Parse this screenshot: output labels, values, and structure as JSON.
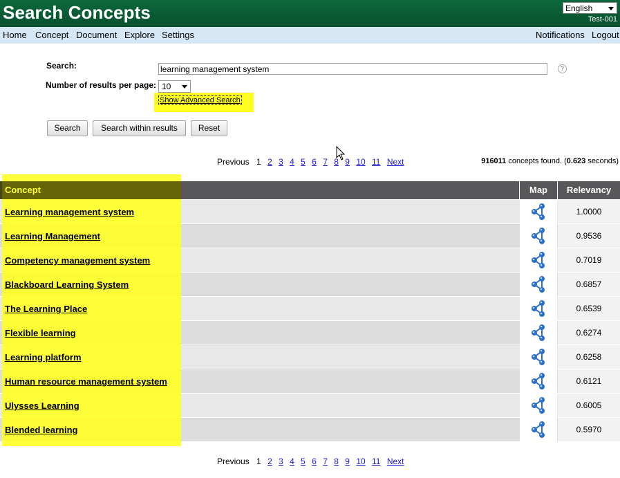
{
  "header": {
    "title": "Search Concepts",
    "language": "English",
    "user": "Test-001"
  },
  "menu": {
    "left": [
      "Home",
      "Concept",
      "Document",
      "Explore",
      "Settings"
    ],
    "right": [
      "Notifications",
      "Logout"
    ]
  },
  "search": {
    "label": "Search:",
    "query": "learning management system",
    "per_page_label": "Number of results per page:",
    "per_page_value": "10",
    "advanced_link": "Show Advanced Search",
    "help": "?",
    "buttons": {
      "search": "Search",
      "search_within": "Search within results",
      "reset": "Reset"
    }
  },
  "pagination": {
    "previous": "Previous",
    "current": "1",
    "pages": [
      "2",
      "3",
      "4",
      "5",
      "6",
      "7",
      "8",
      "9",
      "10",
      "11"
    ],
    "next": "Next"
  },
  "results_summary": {
    "count": "916011",
    "count_text": " concepts found. (",
    "seconds": "0.623",
    "seconds_text": " seconds)"
  },
  "table": {
    "headers": {
      "concept": "Concept",
      "map": "Map",
      "relevancy": "Relevancy"
    },
    "rows": [
      {
        "concept": "Learning management system",
        "relevancy": "1.0000"
      },
      {
        "concept": "Learning Management",
        "relevancy": "0.9536"
      },
      {
        "concept": "Competency management system",
        "relevancy": "0.7019"
      },
      {
        "concept": "Blackboard Learning System",
        "relevancy": "0.6857"
      },
      {
        "concept": "The Learning Place",
        "relevancy": "0.6539"
      },
      {
        "concept": "Flexible learning",
        "relevancy": "0.6274"
      },
      {
        "concept": "Learning platform",
        "relevancy": "0.6258"
      },
      {
        "concept": "Human resource management system",
        "relevancy": "0.6121"
      },
      {
        "concept": "Ulysses Learning",
        "relevancy": "0.6005"
      },
      {
        "concept": "Blended learning",
        "relevancy": "0.5970"
      }
    ]
  },
  "colors": {
    "header_green": "#0b5a34",
    "menu_bg": "#d6e8f5",
    "highlight": "#ffff1f",
    "table_header": "#58585a",
    "link_blue": "#1a1ad6",
    "map_icon_blue": "#2a6fc9"
  },
  "icons": {
    "map": "network-map-icon",
    "help": "help-icon",
    "dropdown": "chevron-down-icon"
  }
}
